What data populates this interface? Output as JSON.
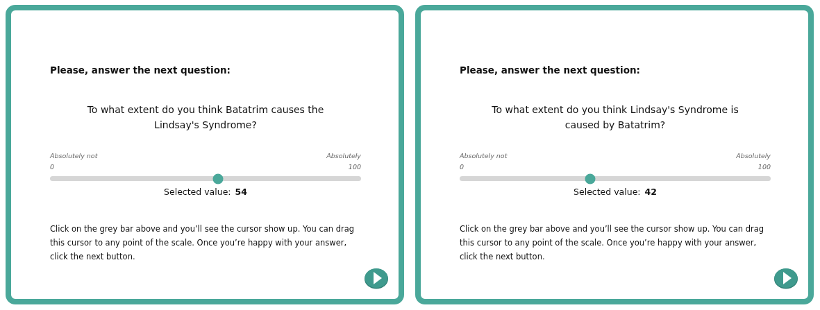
{
  "panels": [
    {
      "heading": "Please, answer the next question:",
      "question": "To what extent do you think Batatrim causes the Lindsay's Syndrome?",
      "slider": {
        "min_caption": "Absolutely not",
        "max_caption": "Absolutely",
        "min": "0",
        "max": "100",
        "level": 0.54
      },
      "selected_label": "Selected value:",
      "selected_value": "54",
      "instructions": "Click on the grey bar above and you’ll see the cursor show up. You can drag this cursor to any point of the scale. Once you’re happy with your answer, click the next button."
    },
    {
      "heading": "Please, answer the next question:",
      "question": "To what extent do you think Lindsay's Syndrome is caused by Batatrim?",
      "slider": {
        "min_caption": "Absolutely not",
        "max_caption": "Absolutely",
        "min": "0",
        "max": "100",
        "level": 0.42
      },
      "selected_label": "Selected value:",
      "selected_value": "42",
      "instructions": "Click on the grey bar above and you’ll see the cursor show up. You can drag this cursor to any point of the scale. Once you’re happy with your answer, click the next button."
    }
  ]
}
